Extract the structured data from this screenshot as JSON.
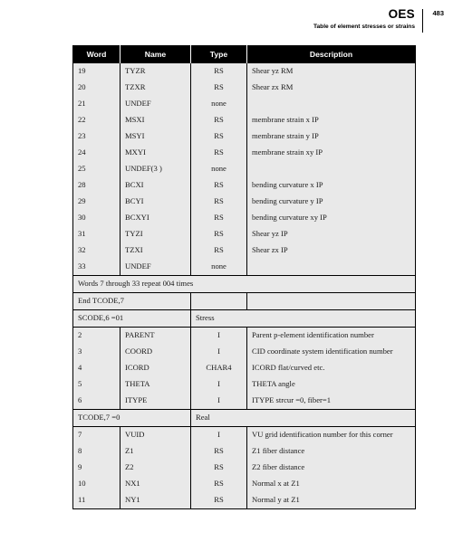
{
  "header": {
    "title": "OES",
    "subtitle": "Table of element stresses or strains",
    "page_number": "483"
  },
  "table": {
    "columns": [
      "Word",
      "Name",
      "Type",
      "Description"
    ],
    "rows": [
      {
        "kind": "data",
        "word": "19",
        "name": "TYZR",
        "type": "RS",
        "desc": "Shear yz RM"
      },
      {
        "kind": "data",
        "word": "20",
        "name": "TZXR",
        "type": "RS",
        "desc": "Shear zx RM"
      },
      {
        "kind": "data",
        "word": "21",
        "name": "UNDEF",
        "type": "none",
        "desc": ""
      },
      {
        "kind": "data",
        "word": "22",
        "name": "MSXI",
        "type": "RS",
        "desc": "membrane strain x IP"
      },
      {
        "kind": "data",
        "word": "23",
        "name": "MSYI",
        "type": "RS",
        "desc": "membrane strain y IP"
      },
      {
        "kind": "data",
        "word": "24",
        "name": "MXYI",
        "type": "RS",
        "desc": "membrane strain xy IP"
      },
      {
        "kind": "data",
        "word": "25",
        "name": "UNDEF(3 )",
        "type": "none",
        "desc": ""
      },
      {
        "kind": "data",
        "word": "28",
        "name": "BCXI",
        "type": "RS",
        "desc": "bending curvature x IP"
      },
      {
        "kind": "data",
        "word": "29",
        "name": "BCYI",
        "type": "RS",
        "desc": "bending curvature y IP"
      },
      {
        "kind": "data",
        "word": "30",
        "name": "BCXYI",
        "type": "RS",
        "desc": "bending curvature xy IP"
      },
      {
        "kind": "data",
        "word": "31",
        "name": "TYZI",
        "type": "RS",
        "desc": "Shear yz IP"
      },
      {
        "kind": "data",
        "word": "32",
        "name": "TZXI",
        "type": "RS",
        "desc": "Shear zx IP"
      },
      {
        "kind": "data",
        "word": "33",
        "name": "UNDEF",
        "type": "none",
        "desc": ""
      },
      {
        "kind": "full",
        "text": "Words 7 through 33 repeat 004 times"
      },
      {
        "kind": "split2",
        "left": "End TCODE,7",
        "type": "",
        "desc": ""
      },
      {
        "kind": "split",
        "left": "SCODE,6 =01",
        "right": "Stress"
      },
      {
        "kind": "data",
        "word": "2",
        "name": "PARENT",
        "type": "I",
        "desc": "Parent p-element identification number"
      },
      {
        "kind": "data",
        "word": "3",
        "name": "COORD",
        "type": "I",
        "desc": "CID coordinate system identification number"
      },
      {
        "kind": "data",
        "word": "4",
        "name": "ICORD",
        "type": "CHAR4",
        "desc": "ICORD flat/curved etc."
      },
      {
        "kind": "data",
        "word": "5",
        "name": "THETA",
        "type": "I",
        "desc": "THETA angle"
      },
      {
        "kind": "data",
        "word": "6",
        "name": "ITYPE",
        "type": "I",
        "desc": "ITYPE strcur =0, fiber=1"
      },
      {
        "kind": "split",
        "left": "TCODE,7 =0",
        "right": "Real"
      },
      {
        "kind": "data",
        "word": "7",
        "name": "VUID",
        "type": "I",
        "desc": "VU grid identification number for this corner"
      },
      {
        "kind": "data",
        "word": "8",
        "name": "Z1",
        "type": "RS",
        "desc": "Z1 fiber distance"
      },
      {
        "kind": "data",
        "word": "9",
        "name": "Z2",
        "type": "RS",
        "desc": "Z2 fiber distance"
      },
      {
        "kind": "data",
        "word": "10",
        "name": "NX1",
        "type": "RS",
        "desc": "Normal x at Z1"
      },
      {
        "kind": "data",
        "word": "11",
        "name": "NY1",
        "type": "RS",
        "desc": "Normal y at Z1"
      }
    ]
  }
}
